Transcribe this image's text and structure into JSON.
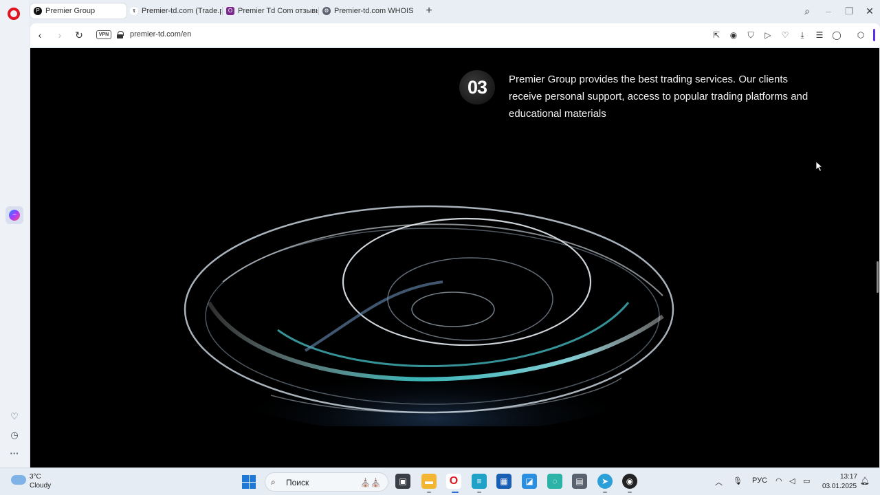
{
  "browser": {
    "tabs": [
      {
        "label": "Premier Group",
        "active": true,
        "favicon": "premier-logo-icon"
      },
      {
        "label": "Premier-td.com (Trade.pre",
        "active": false,
        "favicon": "trustpilot-icon"
      },
      {
        "label": "Premier Td Com отзывы :",
        "active": false,
        "favicon": "reviews-site-icon"
      },
      {
        "label": "Premier-td.com WHOIS, D",
        "active": false,
        "favicon": "whois-gear-icon"
      }
    ],
    "address": {
      "vpn_label": "VPN",
      "url": "premier-td.com/en"
    }
  },
  "page": {
    "step_number": "03",
    "description": "Premier Group provides the best trading services. Our clients receive personal support, access to popular trading platforms and educational materials"
  },
  "taskbar": {
    "weather_temp": "3°C",
    "weather_desc": "Cloudy",
    "search_label": "Поиск",
    "language": "РУС",
    "time": "13:17",
    "date": "03.01.2025"
  },
  "colors": {
    "opera_red": "#e0141e",
    "page_bg": "#000000",
    "accent_teal": "#3fc7c9",
    "sidebar_bg": "#eef2f7"
  }
}
